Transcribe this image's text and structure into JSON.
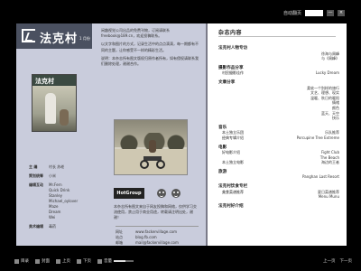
{
  "topbar": {
    "nav_label": "自动翻页",
    "page_display": "",
    "btn_minimize": "—",
    "btn_close": "×"
  },
  "magazine": {
    "logo_text": "法克村",
    "issue": "1 月份"
  },
  "intro": {
    "p1": "闲趣视觉公司出品的免费刊物，订阅请联系 freebook@189.cn，欢迎投稿联系。",
    "p2": "以文字和图片的方式，记录生活中的点点滴滴，每一期都有不同的主题，让你感受不一样的精彩生活。",
    "p3": "说明：本杂志所有图文版权归原作者所有，如有侵权请联系我们删除处理，谢谢合作。"
  },
  "cover": {
    "title": "法克村"
  },
  "meta": {
    "editor_key": "主 编",
    "editor_val": "村长  苏老",
    "planner_key": "策划统筹",
    "planner_val": "小米",
    "team_key": "编辑互动",
    "team": [
      "Mr.Fern",
      "Quick Drink",
      "Stanley",
      "Michael_oylover",
      "Maze",
      "Dream",
      "Wei"
    ],
    "design_key": "美术编辑",
    "design_val": "毒药"
  },
  "notice": "本杂志所有图文来自于网友投稿和网络，仅供学习交流使用，禁止用于商业用途，转载请注明出处，谢谢！",
  "brand": "HotGroup",
  "contact": {
    "web_key": "网址",
    "web_val": "www.fackervillage.com",
    "site_key": "站点",
    "site_val": "blog.fb.com",
    "mail_key": "邮箱",
    "mail_val": "mail@fackervillage.com"
  },
  "toc": {
    "title": "杂志内容",
    "sections": [
      {
        "heading": "法克村人物专访",
        "lines": [
          {
            "l": "",
            "r": "徐海与周峰"
          },
          {
            "l": "",
            "r": "与《周峰》"
          }
        ]
      },
      {
        "heading": "摄影作品分享",
        "lines": [
          {
            "l": "村民摄影佳作",
            "r": "Lucky Dream"
          }
        ]
      },
      {
        "heading": "文章分享",
        "lines": [
          {
            "l": "",
            "r": "柔软一个别样的旅行"
          },
          {
            "l": "",
            "r": "文艺、理想、现实"
          },
          {
            "l": "",
            "r": "温暖、秋日的暖阳"
          },
          {
            "l": "",
            "r": "情绪"
          },
          {
            "l": "",
            "r": "颜色"
          },
          {
            "l": "",
            "r": "蓝天、天空"
          },
          {
            "l": "",
            "r": "快乐"
          }
        ]
      },
      {
        "heading": "音乐",
        "lines": [
          {
            "l": "本土独立乐团",
            "r": "乐队推荐"
          },
          {
            "l": "经典专辑介绍",
            "r": "Porcupine Tree Extreme"
          }
        ]
      },
      {
        "heading": "电影",
        "lines": [
          {
            "l": "好电影介绍",
            "r": "Fight Club"
          },
          {
            "l": "",
            "r": "The Beach"
          },
          {
            "l": "本土独立电影",
            "r": "海边的王者"
          }
        ]
      },
      {
        "heading": "旅游",
        "lines": [
          {
            "l": "",
            "r": "Panghan Last Resort"
          }
        ]
      },
      {
        "heading": "法克村饮食专栏",
        "lines": [
          {
            "l": "美食菜谱推荐",
            "r": "夏日菜谱推荐"
          },
          {
            "l": "",
            "r": "Menu Munu"
          }
        ]
      },
      {
        "heading": "法克村好介绍",
        "lines": []
      }
    ]
  },
  "bottombar": {
    "btn1": "目录",
    "btn2": "封面",
    "btn3": "上页",
    "btn4": "下页",
    "volume_label": "音量",
    "volume_level": 0.6,
    "prev": "上一页",
    "next": "下一页"
  }
}
